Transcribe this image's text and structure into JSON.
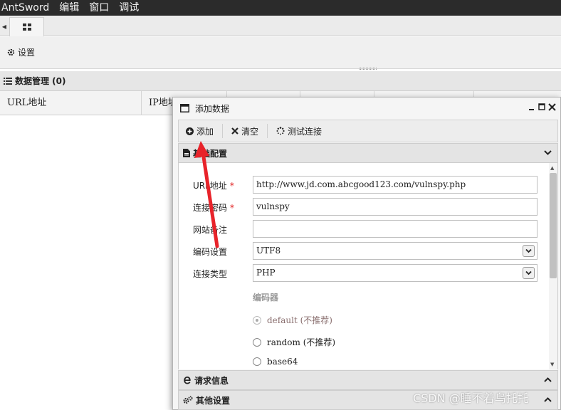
{
  "menubar": {
    "app": "AntSword",
    "items": [
      "编辑",
      "窗口",
      "调试"
    ]
  },
  "toolbar": {
    "settings_label": "设置"
  },
  "data_manager": {
    "title": "数据管理 (0)",
    "columns": [
      "URL地址",
      "IP地址"
    ]
  },
  "dialog": {
    "title": "添加数据",
    "buttons": {
      "add": "添加",
      "clear": "清空",
      "test": "测试连接"
    },
    "sections": {
      "basic": "基础配置",
      "request": "请求信息",
      "other": "其他设置"
    },
    "fields": {
      "url": {
        "label": "URL地址",
        "value": "http://www.jd.com.abcgood123.com/vulnspy.php",
        "required": "*"
      },
      "password": {
        "label": "连接密码",
        "value": "vulnspy",
        "required": "*"
      },
      "note": {
        "label": "网站备注",
        "value": ""
      },
      "encoding": {
        "label": "编码设置",
        "value": "UTF8"
      },
      "type": {
        "label": "连接类型",
        "value": "PHP"
      }
    },
    "encoder": {
      "label": "编码器",
      "options": [
        "default (不推荐)",
        "random (不推荐)",
        "base64"
      ],
      "selected": "default (不推荐)"
    }
  },
  "watermark": "CSDN @睡不着乌托托",
  "colors": {
    "menubar_bg": "#2b2b2b",
    "annotation_arrow": "#e8232a",
    "required_mark": "#e02020"
  }
}
